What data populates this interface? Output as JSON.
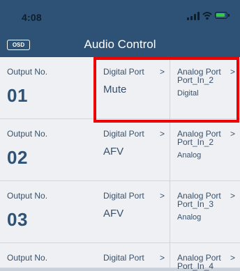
{
  "status_bar": {
    "time": "4:08",
    "icons": [
      "signal-icon",
      "wifi-icon",
      "battery-charging-icon"
    ]
  },
  "nav": {
    "osd_label": "OSD",
    "title": "Audio Control"
  },
  "outputs": [
    {
      "label": "Output No.",
      "number": "01",
      "digital_label": "Digital Port",
      "digital_arrow": ">",
      "digital_value": "Mute",
      "analog_label": "Analog Port",
      "analog_arrow": ">",
      "analog_port": "Port_In_2",
      "analog_type": "Digital"
    },
    {
      "label": "Output No.",
      "number": "02",
      "digital_label": "Digital Port",
      "digital_arrow": ">",
      "digital_value": "AFV",
      "analog_label": "Analog Port",
      "analog_arrow": ">",
      "analog_port": "Port_In_2",
      "analog_type": "Analog"
    },
    {
      "label": "Output No.",
      "number": "03",
      "digital_label": "Digital Port",
      "digital_arrow": ">",
      "digital_value": "AFV",
      "analog_label": "Analog Port",
      "analog_arrow": ">",
      "analog_port": "Port_In_3",
      "analog_type": "Analog"
    },
    {
      "label": "Output No.",
      "number": "",
      "digital_label": "Digital Port",
      "digital_arrow": ">",
      "digital_value": "",
      "analog_label": "Analog Port",
      "analog_arrow": ">",
      "analog_port": "Port_In_4",
      "analog_type": ""
    }
  ],
  "colors": {
    "header": "#2d5276",
    "row_background": "#eef0f3",
    "text": "#39506a",
    "highlight": "#ee0000"
  }
}
